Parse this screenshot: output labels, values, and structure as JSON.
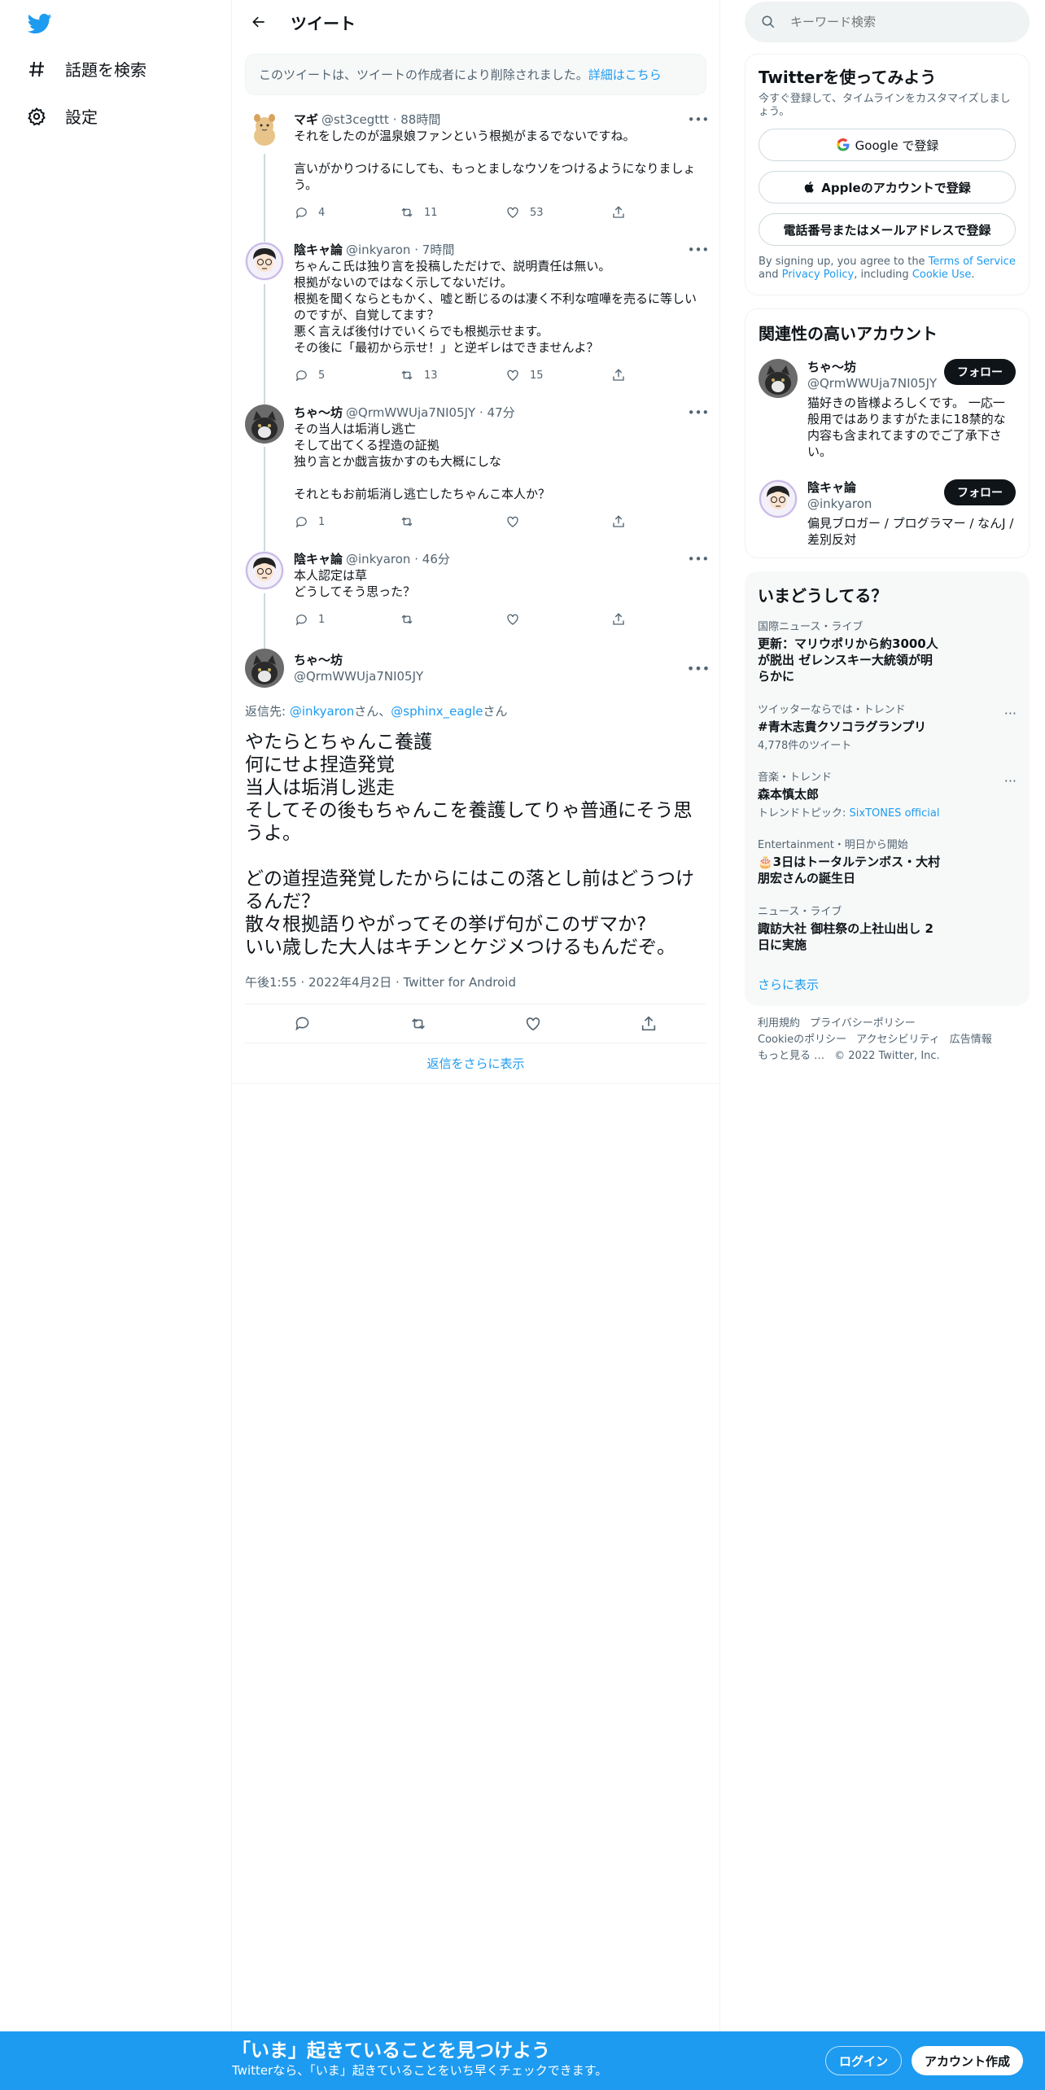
{
  "colors": {
    "accent": "#1d9bf0",
    "text": "#0f1419",
    "muted": "#536471",
    "follow_bg": "#0f1419"
  },
  "sidebar": {
    "logo_icon": "twitter-bird-icon",
    "items": [
      {
        "icon": "hashtag-icon",
        "label": "話題を検索"
      },
      {
        "icon": "gear-icon",
        "label": "設定"
      }
    ]
  },
  "header": {
    "back_icon": "arrow-left-icon",
    "title": "ツイート"
  },
  "deleted_notice": {
    "text": "このツイートは、ツイートの作成者により削除されました。",
    "link": "詳細はこちら"
  },
  "thread": [
    {
      "name": "マギ",
      "handle": "@st3cegttt",
      "sep": "·",
      "time": "88時間",
      "text": "それをしたのが温泉娘ファンという根拠がまるでないですね。\n\n言いがかりつけるにしても、もっとましなウソをつけるようになりましょう。",
      "replies": "4",
      "retweets": "11",
      "likes": "53"
    },
    {
      "name": "陰キャ論",
      "handle": "@inkyaron",
      "sep": "·",
      "time": "7時間",
      "text": "ちゃんこ氏は独り言を投稿しただけで、説明責任は無い。\n根拠がないのではなく示してないだけ。\n根拠を聞くならともかく、嘘と断じるのは凄く不利な喧嘩を売るに等しいのですが、自覚してます？\n悪く言えば後付けでいくらでも根拠示せます。\nその後に「最初から示せ！」と逆ギレはできませんよ？",
      "replies": "5",
      "retweets": "13",
      "likes": "15"
    },
    {
      "name": "ちゃ〜坊",
      "handle": "@QrmWWUja7NI05JY",
      "sep": "·",
      "time": "47分",
      "text": "その当人は垢消し逃亡\nそして出てくる捏造の証拠\n独り言とか戯言抜かすのも大概にしな\n\nそれともお前垢消し逃亡したちゃんこ本人か？",
      "replies": "1",
      "retweets": "",
      "likes": ""
    },
    {
      "name": "陰キャ論",
      "handle": "@inkyaron",
      "sep": "·",
      "time": "46分",
      "text": "本人認定は草\nどうしてそう思った？",
      "replies": "1",
      "retweets": "",
      "likes": ""
    }
  ],
  "focal": {
    "name": "ちゃ〜坊",
    "handle": "@QrmWWUja7NI05JY",
    "reply_prefix": "返信先: ",
    "reply_user1": "@inkyaron",
    "reply_san1": "さん、",
    "reply_user2": "@sphinx_eagle",
    "reply_san2": "さん",
    "text": "やたらとちゃんこ養護\n何にせよ捏造発覚\n当人は垢消し逃走\nそしてその後もちゃんこを養護してりゃ普通にそう思うよ。\n\nどの道捏造発覚したからにはこの落とし前はどうつけるんだ？\n散々根拠語りやがってその挙げ句がこのザマか?\nいい歳した大人はキチンとケジメつけるもんだぞ。",
    "meta": "午後1:55 · 2022年4月2日 · Twitter for Android"
  },
  "show_more_replies": "返信をさらに表示",
  "search": {
    "placeholder": "キーワード検索"
  },
  "signup_card": {
    "title": "Twitterを使ってみよう",
    "subtitle": "今すぐ登録して、タイムラインをカスタマイズしましょう。",
    "google": "Google で登録",
    "apple": "Appleのアカウントで登録",
    "phone": "電話番号またはメールアドレスで登録",
    "terms_pre": "By signing up, you agree to the ",
    "terms_tos": "Terms of Service",
    "terms_and": " and ",
    "terms_privacy": "Privacy Policy",
    "terms_incl": ", including ",
    "terms_cookie": "Cookie Use",
    "terms_end": "."
  },
  "related": {
    "title": "関連性の高いアカウント",
    "accounts": [
      {
        "name": "ちゃ〜坊",
        "handle": "@QrmWWUja7NI05JY",
        "follow": "フォロー",
        "bio": "猫好きの皆様よろしくです。 一応一般用ではありますがたまに18禁的な内容も含まれてますのでご了承下さい。"
      },
      {
        "name": "陰キャ論",
        "handle": "@inkyaron",
        "follow": "フォロー",
        "bio": "偏見ブロガー / プログラマー / なんJ / 差別反対"
      }
    ]
  },
  "trends": {
    "title": "いまどうしてる？",
    "items": [
      {
        "category": "国際ニュース・ライブ",
        "title": "更新：マリウポリから約3000人が脱出 ゼレンスキー大統領が明らかに",
        "sub": "",
        "sub_link": ""
      },
      {
        "category": "ツイッターならでは・トレンド",
        "title": "#青木志貴クソコラグランプリ",
        "sub": "4,778件のツイート",
        "sub_link": ""
      },
      {
        "category": "音楽・トレンド",
        "title": "森本慎太郎",
        "sub": "トレンドトピック: ",
        "sub_link": "SixTONES official"
      },
      {
        "category": "Entertainment・明日から開始",
        "title": "🎂3日はトータルテンボス・大村朋宏さんの誕生日",
        "sub": "",
        "sub_link": ""
      },
      {
        "category": "ニュース・ライブ",
        "title": "諏訪大社 御柱祭の上社山出し 2日に実施",
        "sub": "",
        "sub_link": ""
      }
    ],
    "more_dots": "···",
    "show_more": "さらに表示"
  },
  "footer": {
    "links": [
      "利用規約",
      "プライバシーポリシー",
      "Cookieのポリシー",
      "アクセシビリティ",
      "広告情報",
      "もっと見る …",
      "© 2022 Twitter, Inc."
    ]
  },
  "bottom_bar": {
    "title": "「いま」起きていることを見つけよう",
    "subtitle": "Twitterなら、「いま」起きていることをいち早くチェックできます。",
    "login": "ログイン",
    "signup": "アカウント作成"
  }
}
